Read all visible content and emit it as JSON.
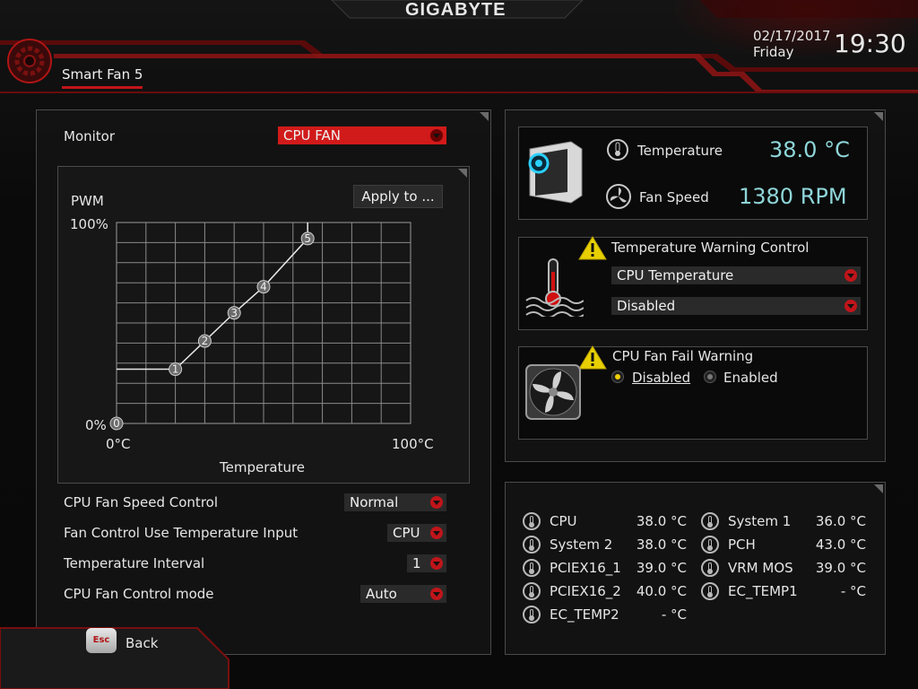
{
  "header": {
    "brand": "GIGABYTE",
    "page_title": "Smart Fan 5",
    "date": "02/17/2017",
    "weekday": "Friday",
    "time": "19:30"
  },
  "monitor": {
    "label": "Monitor",
    "selected": "CPU FAN"
  },
  "curve": {
    "apply_label": "Apply to ...",
    "y_label": "PWM",
    "y_max": "100%",
    "y_min": "0%",
    "x_min": "0°C",
    "x_max": "100°C",
    "x_label": "Temperature",
    "points": [
      {
        "label": "0",
        "temp": 0,
        "pwm": 0
      },
      {
        "label": "1",
        "temp": 20,
        "pwm": 27
      },
      {
        "label": "2",
        "temp": 30,
        "pwm": 41
      },
      {
        "label": "3",
        "temp": 40,
        "pwm": 55
      },
      {
        "label": "4",
        "temp": 50,
        "pwm": 68
      },
      {
        "label": "5",
        "temp": 65,
        "pwm": 92
      }
    ]
  },
  "settings": [
    {
      "label": "CPU Fan Speed Control",
      "value": "Normal"
    },
    {
      "label": "Fan Control Use Temperature Input",
      "value": "CPU"
    },
    {
      "label": "Temperature Interval",
      "value": "1"
    },
    {
      "label": "CPU Fan Control mode",
      "value": "Auto"
    }
  ],
  "back": {
    "key": "Esc",
    "label": "Back"
  },
  "status": {
    "temp_label": "Temperature",
    "temp_value": "38.0 °C",
    "fan_label": "Fan Speed",
    "fan_value": "1380 RPM"
  },
  "temp_warning": {
    "title": "Temperature Warning Control",
    "source": "CPU Temperature",
    "level": "Disabled"
  },
  "fan_fail": {
    "title": "CPU Fan Fail Warning",
    "option_disabled": "Disabled",
    "option_enabled": "Enabled",
    "selected": "Disabled"
  },
  "sensors": [
    {
      "name": "CPU",
      "value": "38.0 °C"
    },
    {
      "name": "System 1",
      "value": "36.0 °C"
    },
    {
      "name": "System 2",
      "value": "38.0 °C"
    },
    {
      "name": "PCH",
      "value": "43.0 °C"
    },
    {
      "name": "PCIEX16_1",
      "value": "39.0 °C"
    },
    {
      "name": "VRM MOS",
      "value": "39.0 °C"
    },
    {
      "name": "PCIEX16_2",
      "value": "40.0 °C"
    },
    {
      "name": "EC_TEMP1",
      "value": "- °C"
    },
    {
      "name": "EC_TEMP2",
      "value": "- °C"
    }
  ],
  "colors": {
    "accent_red": "#c0151a",
    "cyan_value": "#8fd6d9",
    "warning_yellow": "#f2d000"
  }
}
